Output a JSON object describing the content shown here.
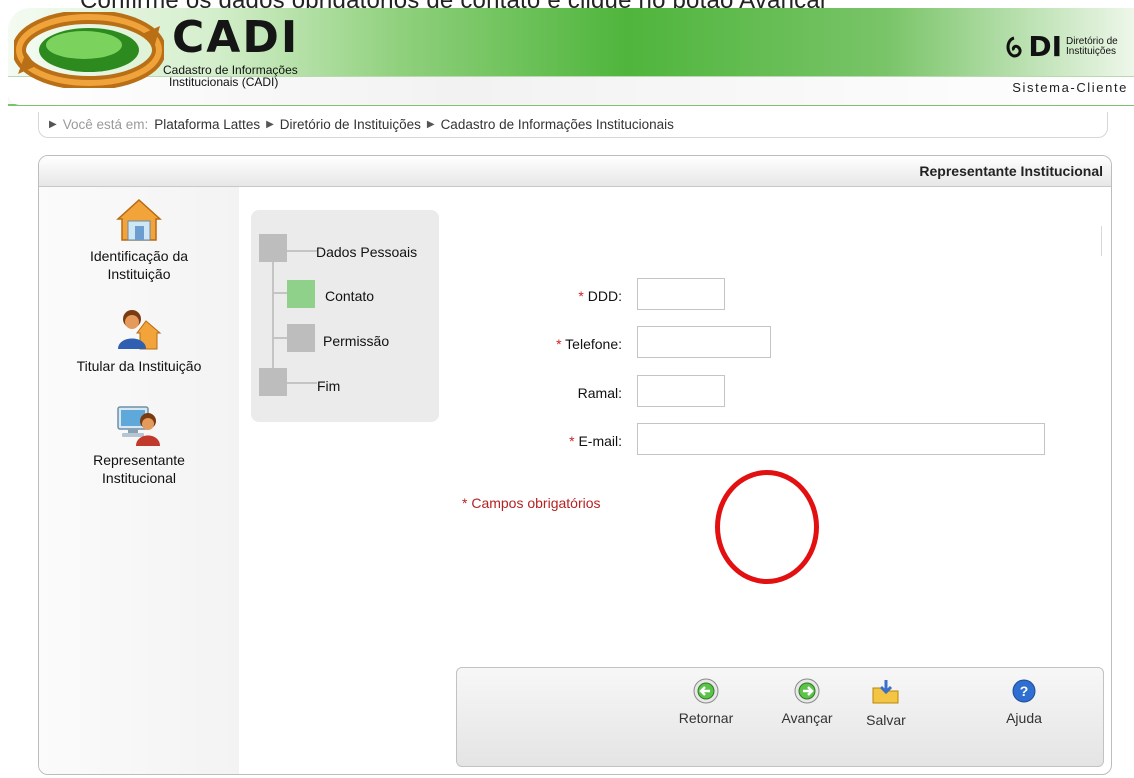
{
  "caption": "Confirme os dados obrigatórios de contato e clique no botão Avançar",
  "header": {
    "brand_title": "CADI",
    "brand_sub_1": "Cadastro de Informações",
    "brand_sub_2": "Institucionais (CADI)",
    "di_mark": "DI",
    "di_text_1": "Diretório de",
    "di_text_2": "Instituições",
    "system_label": "Sistema-Cliente"
  },
  "breadcrumb": {
    "prefix": "Você está em:",
    "items": [
      "Plataforma Lattes",
      "Diretório de Instituições",
      "Cadastro de Informações Institucionais"
    ]
  },
  "panel": {
    "title": "Representante Institucional"
  },
  "sidebar": {
    "items": [
      {
        "label_1": "Identificação da",
        "label_2": "Instituição",
        "icon": "house-icon"
      },
      {
        "label_1": "Titular da Instituição",
        "icon": "person-house-icon"
      },
      {
        "label_1": "Representante",
        "label_2": "Institucional",
        "icon": "person-computer-icon"
      }
    ]
  },
  "steps": {
    "items": [
      "Dados Pessoais",
      "Contato",
      "Permissão",
      "Fim"
    ],
    "active": "Contato"
  },
  "form": {
    "ddd_label": "DDD:",
    "telefone_label": "Telefone:",
    "ramal_label": "Ramal:",
    "email_label": "E-mail:",
    "required_mark": "*",
    "ddd_value": "",
    "telefone_value": "",
    "ramal_value": "",
    "email_value": "",
    "required_note": "* Campos obrigatórios"
  },
  "actions": {
    "retornar": "Retornar",
    "avancar": "Avançar",
    "salvar": "Salvar",
    "ajuda": "Ajuda"
  },
  "colors": {
    "header_green": "#4fb53c",
    "step_active": "#8fd08a",
    "required_red": "#cc2222",
    "highlight_ring": "#e21010"
  }
}
